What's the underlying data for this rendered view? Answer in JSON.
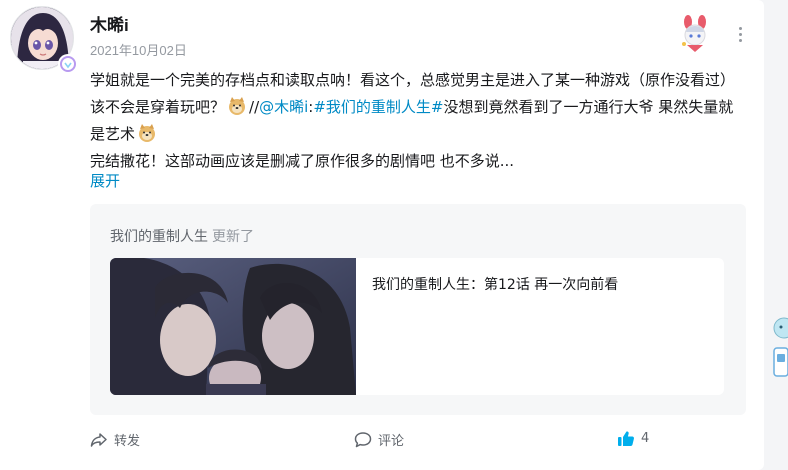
{
  "post": {
    "username": "木晞i",
    "date": "2021年10月02日",
    "text": {
      "line1_part1": "学姐就是一个完美的存档点和读取点呐！看这个，总感觉男主是进入了某一种游戏（原作没看过）该不会是穿着玩吧？",
      "separator": "//",
      "mention": "@木晞i",
      "colon": ":",
      "topic": "#我们的重制人生#",
      "line1_part2": "没想到竟然看到了一方通行大爷 果然失量就是艺术",
      "line2": "完结撒花！这部动画应该是删减了原作很多的剧情吧 也不多说..."
    },
    "expand_label": "展开"
  },
  "share": {
    "series_name": "我们的重制人生",
    "update_label": "更新了",
    "episode_title": "我们的重制人生：第12话 再一次向前看"
  },
  "actions": {
    "forward_label": "转发",
    "comment_label": "评论",
    "like_count": "4"
  },
  "colors": {
    "link": "#008ac5",
    "like": "#00aeec",
    "text": "#18191c",
    "muted": "#9499a0"
  },
  "icons": {
    "more": "more-vertical-icon",
    "forward": "forward-icon",
    "comment": "comment-icon",
    "like": "thumbs-up-icon",
    "emoji": "doge-emoji"
  }
}
